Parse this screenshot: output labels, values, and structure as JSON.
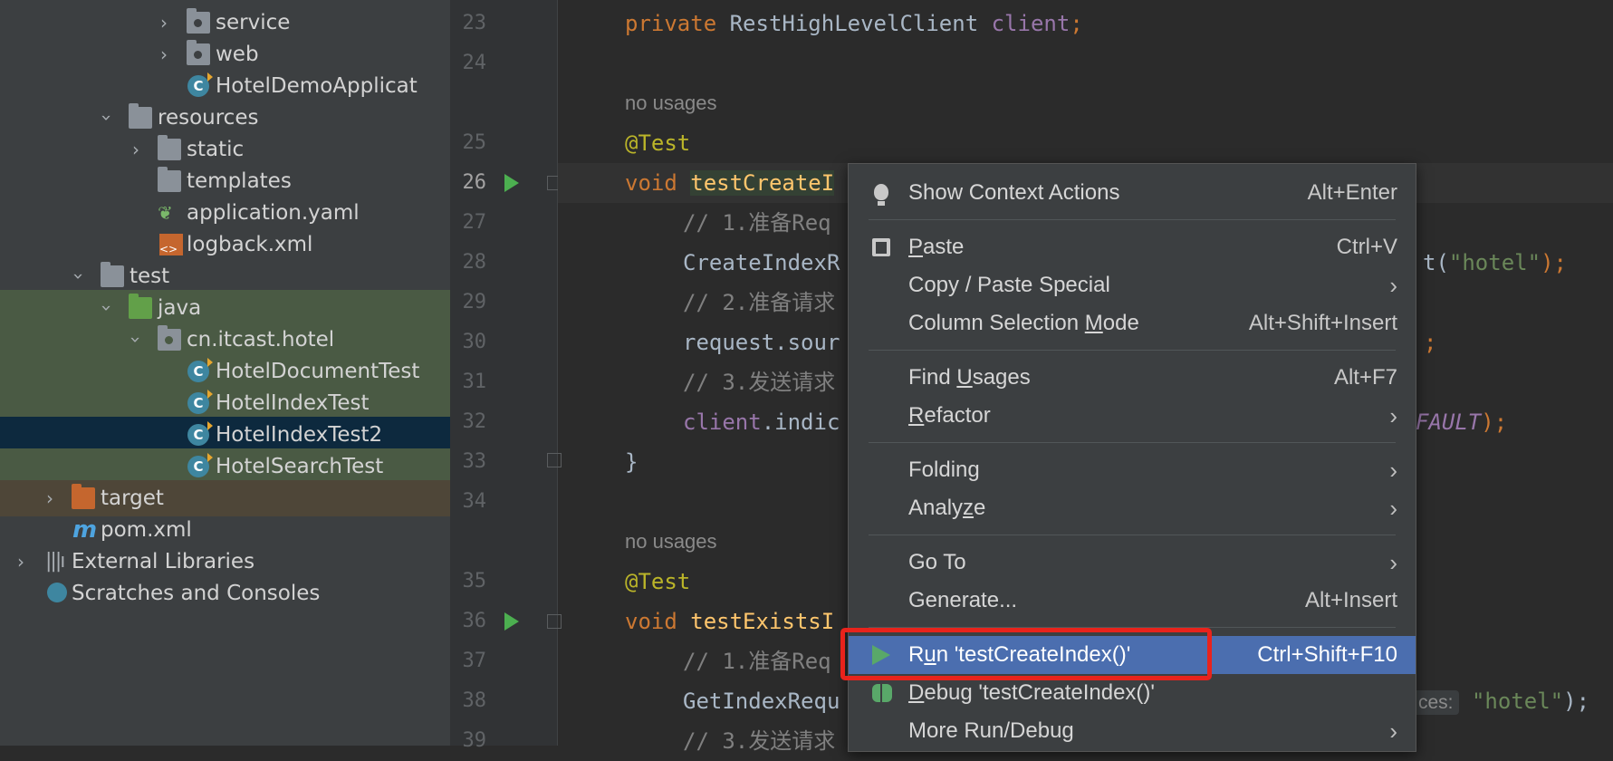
{
  "project_tree": {
    "items": [
      {
        "label": "service",
        "icon": "folder-package-icon",
        "expand": "collapsed"
      },
      {
        "label": "web",
        "icon": "folder-package-icon",
        "expand": "collapsed"
      },
      {
        "label": "HotelDemoApplicat",
        "icon": "spring-class-icon",
        "expand": "none"
      },
      {
        "label": "resources",
        "icon": "resources-folder-icon",
        "expand": "expanded"
      },
      {
        "label": "static",
        "icon": "folder-icon",
        "expand": "collapsed"
      },
      {
        "label": "templates",
        "icon": "folder-icon",
        "expand": "none"
      },
      {
        "label": "application.yaml",
        "icon": "yaml-icon",
        "expand": "none"
      },
      {
        "label": "logback.xml",
        "icon": "xml-icon",
        "expand": "none"
      },
      {
        "label": "test",
        "icon": "folder-icon",
        "expand": "expanded"
      },
      {
        "label": "java",
        "icon": "test-folder-icon",
        "expand": "expanded"
      },
      {
        "label": "cn.itcast.hotel",
        "icon": "package-icon",
        "expand": "expanded"
      },
      {
        "label": "HotelDocumentTest",
        "icon": "test-class-icon",
        "expand": "none"
      },
      {
        "label": "HotelIndexTest",
        "icon": "test-class-icon",
        "expand": "none"
      },
      {
        "label": "HotelIndexTest2",
        "icon": "test-class-icon",
        "expand": "none",
        "selected": true
      },
      {
        "label": "HotelSearchTest",
        "icon": "test-class-icon",
        "expand": "none"
      },
      {
        "label": "target",
        "icon": "excluded-folder-icon",
        "expand": "collapsed"
      },
      {
        "label": "pom.xml",
        "icon": "maven-icon",
        "expand": "none"
      },
      {
        "label": "External Libraries",
        "icon": "libraries-icon",
        "expand": "collapsed"
      },
      {
        "label": "Scratches and Consoles",
        "icon": "scratches-icon",
        "expand": "none"
      }
    ]
  },
  "gutter": {
    "line_numbers": [
      "23",
      "24",
      "25",
      "26",
      "27",
      "28",
      "29",
      "30",
      "31",
      "32",
      "33",
      "34",
      "35",
      "36",
      "37",
      "38",
      "39"
    ]
  },
  "editor": {
    "line23": {
      "kw": "private",
      "type": "RestHighLevelClient",
      "field": "client",
      "semi": ";"
    },
    "hint1": "no usages",
    "line25": "@Test",
    "line26": {
      "kw": "void",
      "fn": "testCreateI"
    },
    "line27": "// 1.准备Req",
    "line28": {
      "code": "CreateIndexR",
      "tail_code": "t(",
      "tail_str": "\"hotel\"",
      "tail_end": ");"
    },
    "line29": "// 2.准备请求",
    "line30": {
      "code": "request.sour",
      "tail": ";"
    },
    "line31": "// 3.发送请求",
    "line32": {
      "field": "client",
      "code": ".indic",
      "tail_ital": "FAULT",
      "tail_end": ");"
    },
    "line33": "}",
    "hint2": "no usages",
    "line35": "@Test",
    "line36": {
      "kw": "void",
      "fn": "testExistsI"
    },
    "line37": "// 1.准备Req",
    "line38": {
      "code": "GetIndexRequ",
      "hint": "ces:",
      "str": "\"hotel\"",
      "end": ");"
    },
    "line39": "// 3.发送请求"
  },
  "context_menu": {
    "items": [
      {
        "id": "show-context-actions",
        "label": "Show Context Actions",
        "shortcut": "Alt+Enter"
      },
      {
        "id": "paste",
        "label_pre": "",
        "mnemonic": "P",
        "label_post": "aste",
        "shortcut": "Ctrl+V"
      },
      {
        "id": "copy-paste-special",
        "label": "Copy / Paste Special",
        "submenu": "›"
      },
      {
        "id": "column-selection-mode",
        "label_pre": "Column Selection ",
        "mnemonic": "M",
        "label_post": "ode",
        "shortcut": "Alt+Shift+Insert"
      },
      {
        "id": "find-usages",
        "label_pre": "Find ",
        "mnemonic": "U",
        "label_post": "sages",
        "shortcut": "Alt+F7"
      },
      {
        "id": "refactor",
        "label_pre": "",
        "mnemonic": "R",
        "label_post": "efactor",
        "submenu": "›"
      },
      {
        "id": "folding",
        "label": "Folding",
        "submenu": "›"
      },
      {
        "id": "analyze",
        "label_pre": "Analy",
        "mnemonic": "z",
        "label_post": "e",
        "submenu": "›"
      },
      {
        "id": "go-to",
        "label": "Go To",
        "submenu": "›"
      },
      {
        "id": "generate",
        "label": "Generate...",
        "shortcut": "Alt+Insert"
      },
      {
        "id": "run",
        "label_pre": "R",
        "mnemonic": "u",
        "label_post": "n 'testCreateIndex()'",
        "shortcut": "Ctrl+Shift+F10",
        "active": true
      },
      {
        "id": "debug",
        "label_pre": "",
        "mnemonic": "D",
        "label_post": "ebug 'testCreateIndex()'"
      },
      {
        "id": "more-run-debug",
        "label": "More Run/Debug",
        "submenu": "›"
      }
    ]
  },
  "colors": {
    "editor_bg": "#2b2b2b",
    "menu_bg": "#3c3f41",
    "menu_active": "#4b6eaf",
    "highlight_box": "#e8231c",
    "run_green": "#4caf50"
  }
}
